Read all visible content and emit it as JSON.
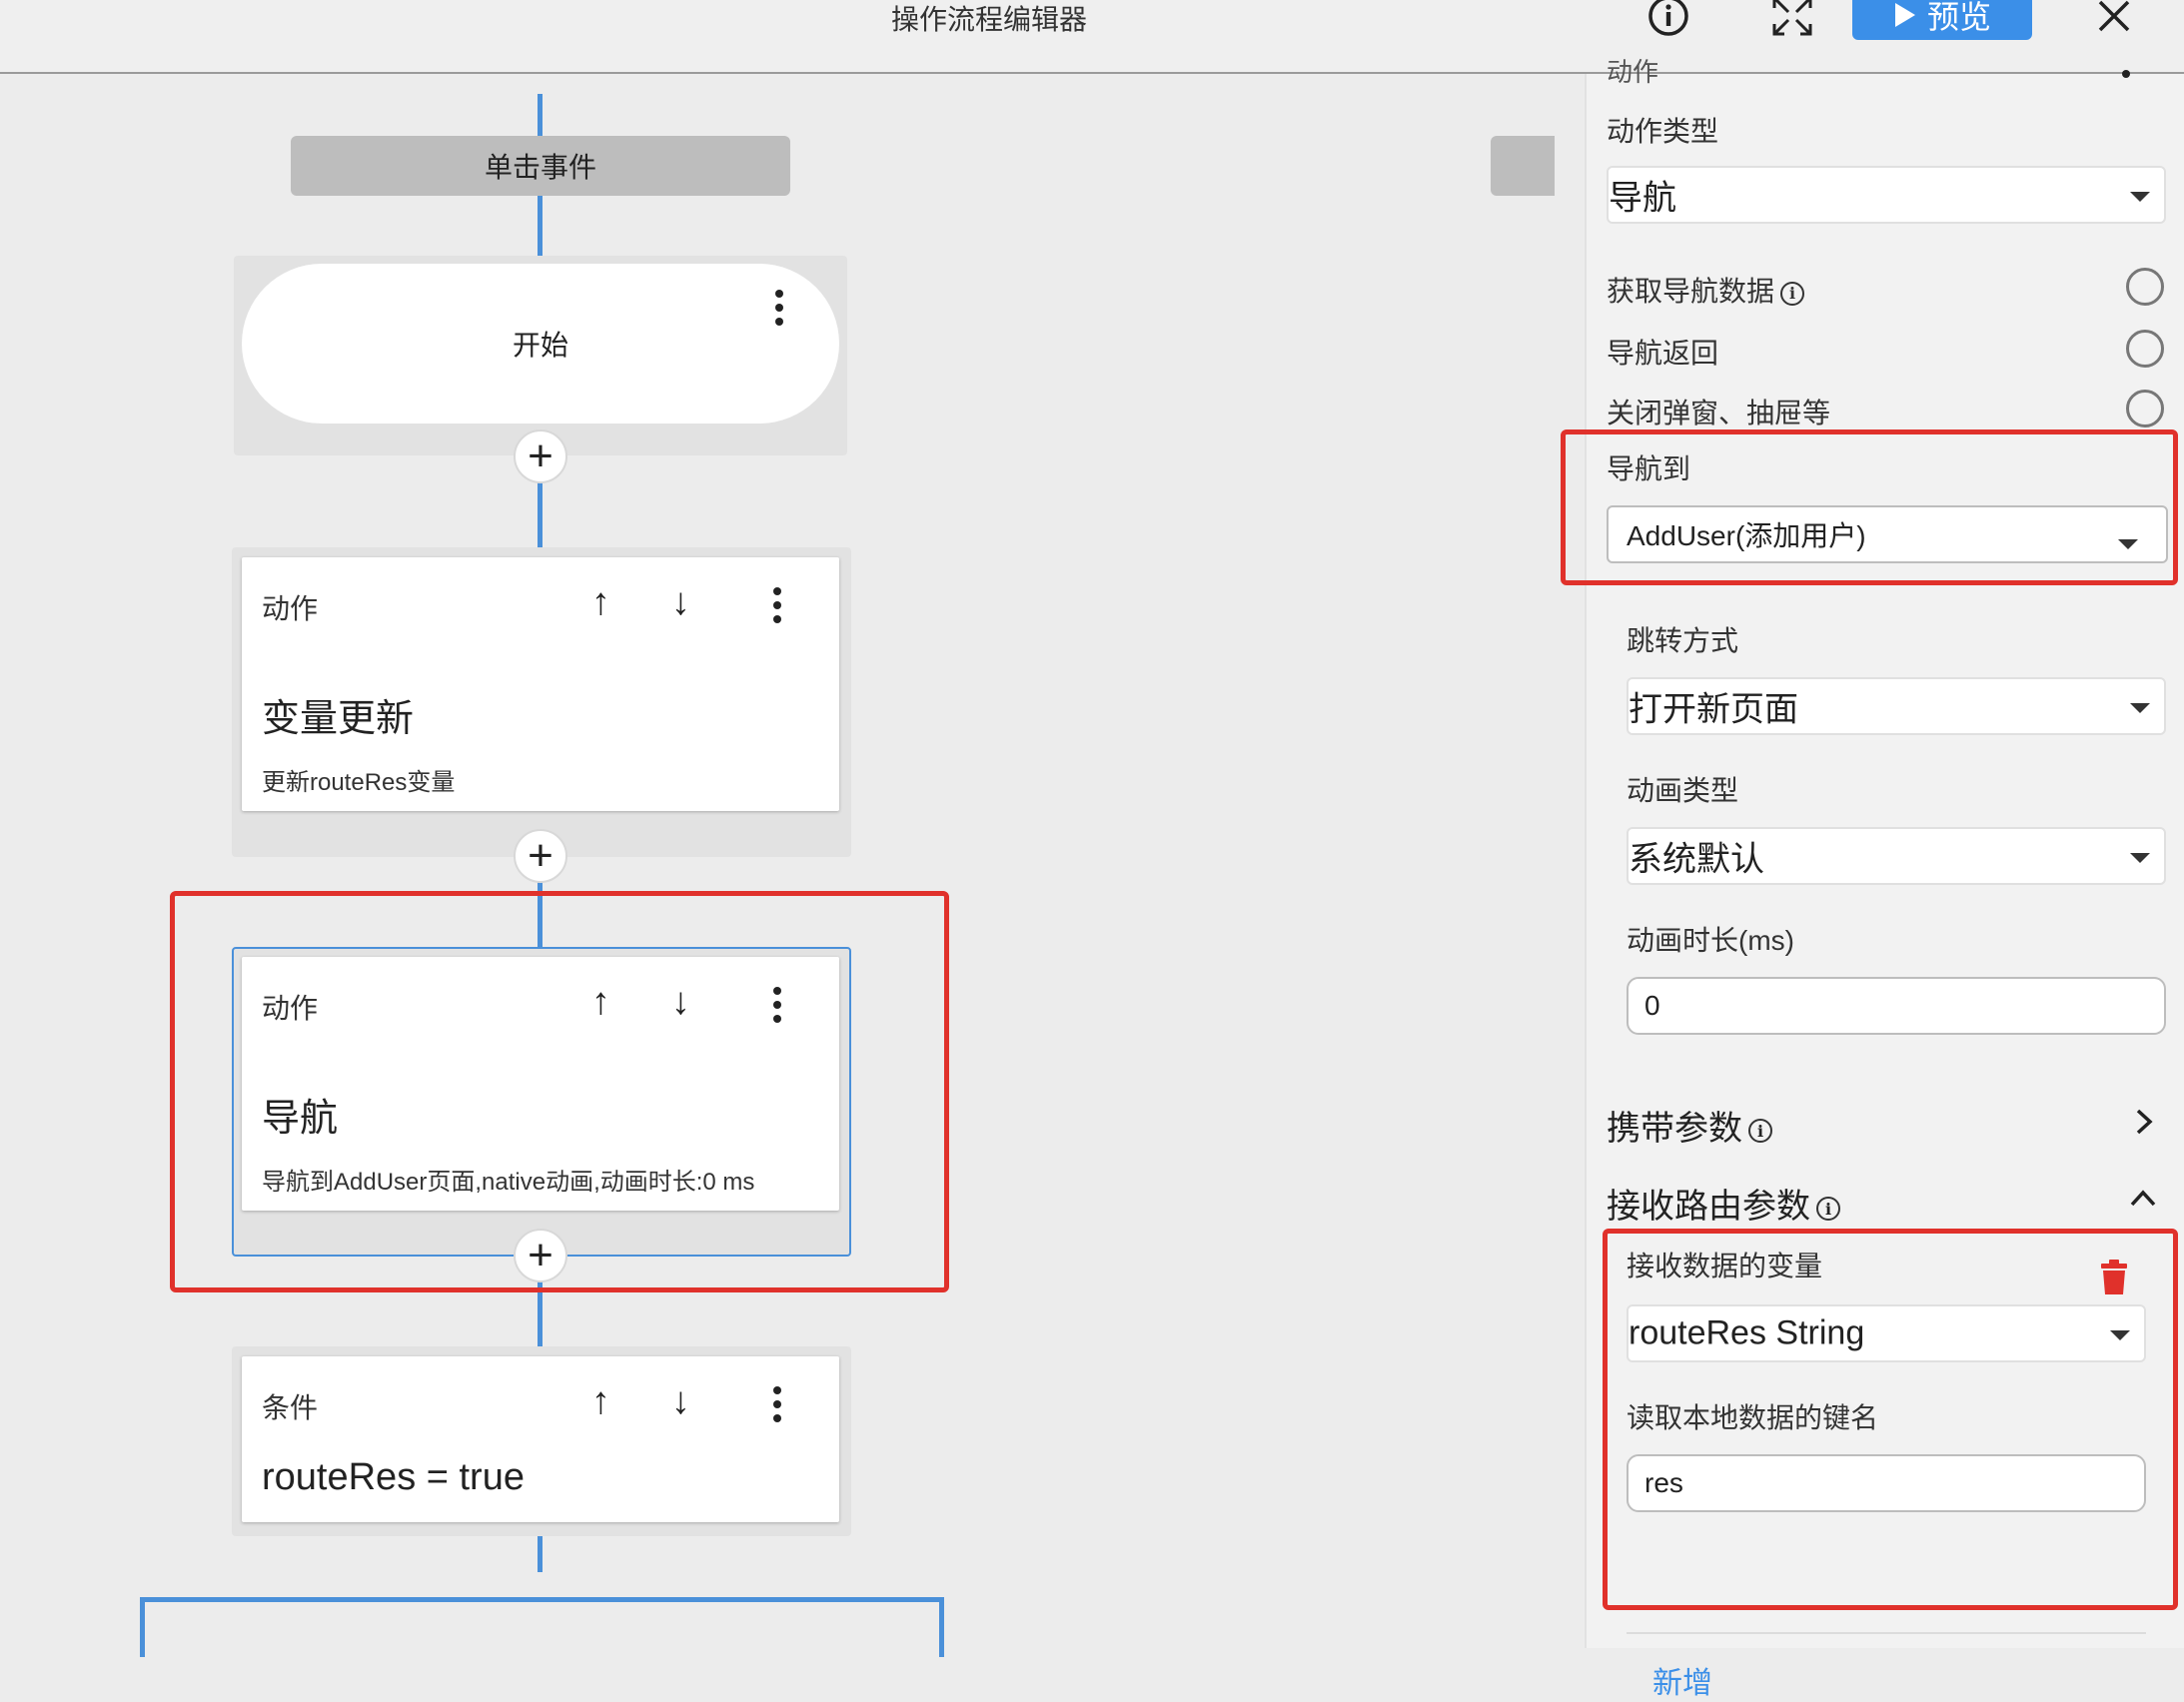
{
  "window": {
    "title": "操作流程编辑器",
    "info_icon": "info-icon",
    "fullscreen_icon": "fullscreen-icon",
    "preview_label": "预览",
    "close_icon": "close-icon"
  },
  "canvas": {
    "event_label": "单击事件",
    "start_label": "开始",
    "nodes": [
      {
        "type": "动作",
        "title": "变量更新",
        "desc": "更新routeRes变量"
      },
      {
        "type": "动作",
        "title": "导航",
        "desc": "导航到AddUser页面,native动画,动画时长:0 ms"
      },
      {
        "type": "条件",
        "title": "routeRes = true",
        "desc": ""
      }
    ],
    "add_symbol": "+",
    "up_symbol": "↑",
    "down_symbol": "↓"
  },
  "panel": {
    "cut_label": "动作",
    "action_type_label": "动作类型",
    "action_type_value": "导航",
    "options": [
      {
        "label": "获取导航数据",
        "has_info": true
      },
      {
        "label": "导航返回",
        "has_info": false
      },
      {
        "label": "关闭弹窗、抽屉等",
        "has_info": false
      }
    ],
    "nav_to_label": "导航到",
    "nav_to_value": "AddUser(添加用户)",
    "jump_mode_label": "跳转方式",
    "jump_mode_value": "打开新页面",
    "anim_type_label": "动画类型",
    "anim_type_value": "系统默认",
    "anim_duration_label": "动画时长(ms)",
    "anim_duration_value": "0",
    "carry_params_label": "携带参数",
    "receive_params_label": "接收路由参数",
    "receive_var_label": "接收数据的变量",
    "receive_var_value": "routeRes String",
    "local_key_label": "读取本地数据的键名",
    "local_key_value": "res",
    "add_label": "新增"
  },
  "colors": {
    "accent": "#3b8fe8",
    "highlight": "#e0312b",
    "delete": "#e0312b",
    "flow_line": "#4a90d9"
  }
}
